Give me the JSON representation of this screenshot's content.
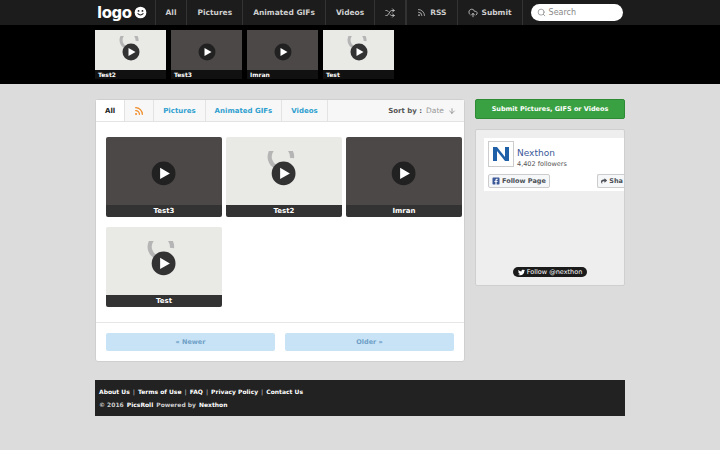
{
  "logo": {
    "text": "logo"
  },
  "nav": {
    "items": [
      {
        "label": "All"
      },
      {
        "label": "Pictures"
      },
      {
        "label": "Animated GIFs"
      },
      {
        "label": "Videos"
      }
    ],
    "rss": "RSS",
    "submit": "Submit",
    "search_placeholder": "Search"
  },
  "strip": [
    {
      "title": "Test2",
      "kind": "placeholder"
    },
    {
      "title": "Test3",
      "kind": "photo"
    },
    {
      "title": "Imran",
      "kind": "photo"
    },
    {
      "title": "Test",
      "kind": "placeholder"
    }
  ],
  "tabs": [
    {
      "label": "All",
      "kind": "text",
      "selected": true
    },
    {
      "kind": "rss",
      "selected": false
    },
    {
      "label": "Pictures",
      "kind": "text",
      "selected": false
    },
    {
      "label": "Animated GIFs",
      "kind": "text",
      "selected": false
    },
    {
      "label": "Videos",
      "kind": "text",
      "selected": false
    }
  ],
  "sort": {
    "label": "Sort by :",
    "value": "Date"
  },
  "posts": [
    {
      "title": "Test3",
      "kind": "photo"
    },
    {
      "title": "Test2",
      "kind": "placeholder"
    },
    {
      "title": "Imran",
      "kind": "photo"
    },
    {
      "title": "Test",
      "kind": "placeholder"
    }
  ],
  "pagination": [
    {
      "label": "« Newer",
      "disabled": true
    },
    {
      "label": "Older »",
      "disabled": true
    }
  ],
  "sidebar": {
    "submit_button": "Submit Pictures, GIFS or Videos",
    "facebook": {
      "page": "Nexthon",
      "followers": "4,402 followers",
      "follow": "Follow Page",
      "share": "Sha"
    },
    "twitter": {
      "follow": "Follow @nexthon"
    }
  },
  "footer": {
    "links": [
      "About Us",
      "Terms of Use",
      "FAQ",
      "Privacy Policy",
      "Contact Us"
    ],
    "separator": "|",
    "copyright": {
      "year": "© 2016",
      "site": "PicsRoll",
      "powered": "Powered by",
      "brand": "Nexthon"
    }
  }
}
